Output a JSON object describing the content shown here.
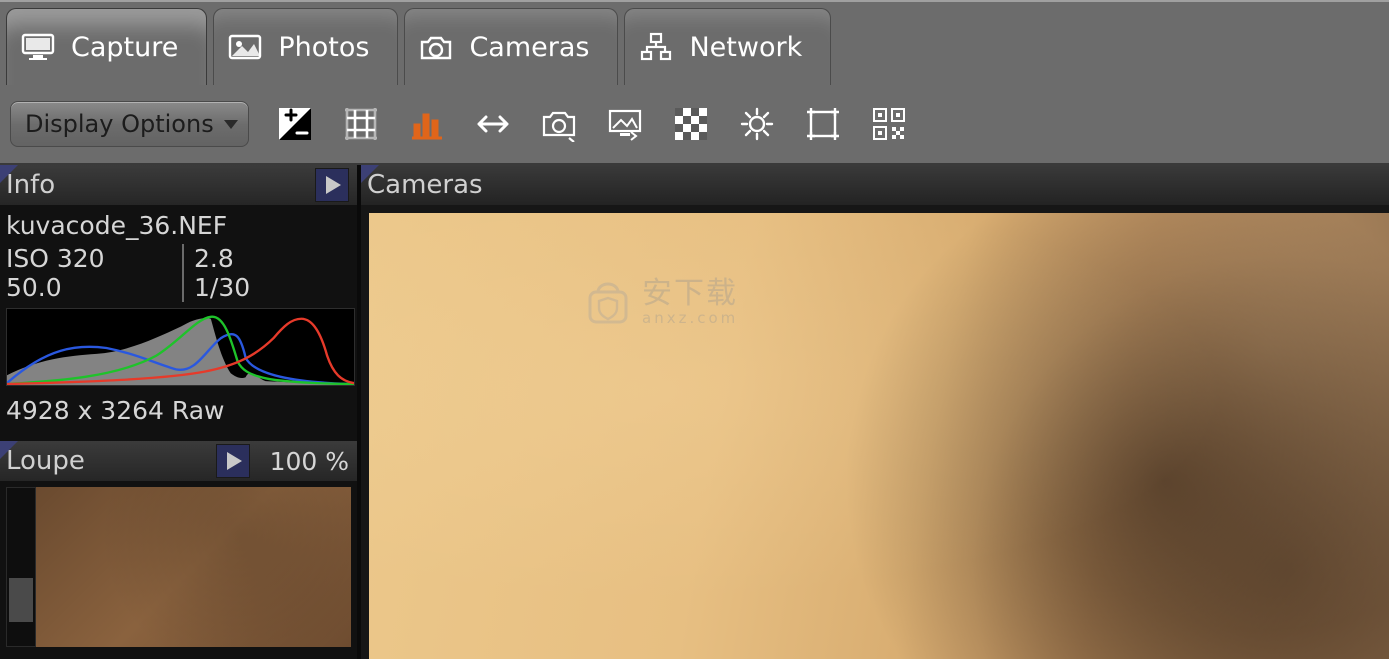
{
  "tabs": [
    {
      "label": "Capture"
    },
    {
      "label": "Photos"
    },
    {
      "label": "Cameras"
    },
    {
      "label": "Network"
    }
  ],
  "toolbar": {
    "display_options_label": "Display Options"
  },
  "sidebar": {
    "info": {
      "title": "Info",
      "filename": "kuvacode_36.NEF",
      "iso": "ISO 320",
      "aperture": "2.8",
      "focal": "50.0",
      "shutter": "1/30",
      "resolution": "4928 x 3264 Raw"
    },
    "loupe": {
      "title": "Loupe",
      "zoom": "100 %"
    }
  },
  "main": {
    "title": "Cameras"
  },
  "watermark": {
    "big": "安下载",
    "small": "anxz.com"
  }
}
